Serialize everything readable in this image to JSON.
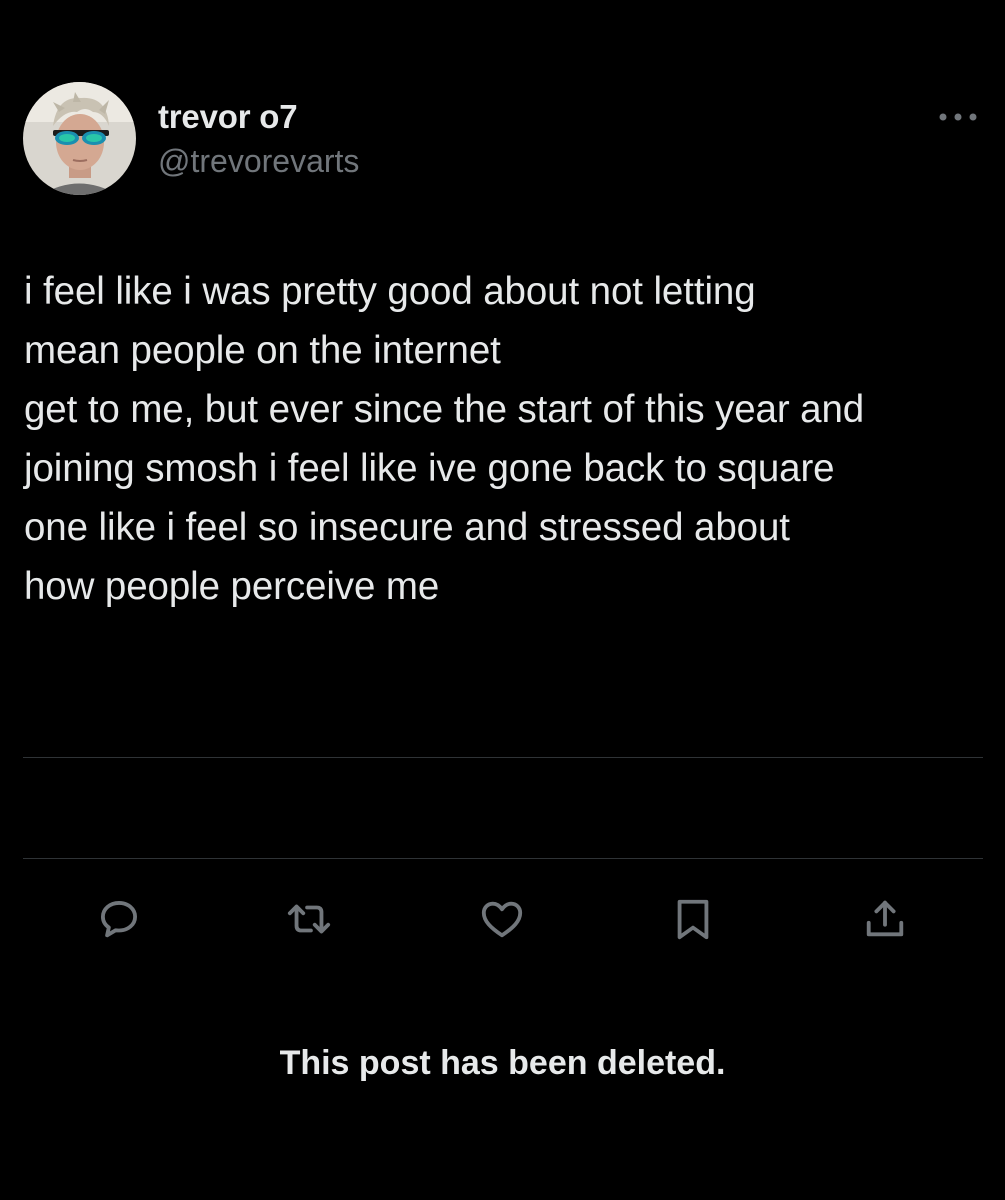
{
  "author": {
    "display_name": "trevor o7",
    "handle": "@trevorevarts",
    "avatar_icon": "profile-photo-avatar"
  },
  "post": {
    "text": "i feel like i was pretty good about not letting\nmean people on the internet\nget to me, but ever since the start of this year and\njoining smosh i feel like ive gone back to square\none like i feel so insecure and stressed about\nhow people perceive me"
  },
  "actions": [
    {
      "name": "reply",
      "icon": "speech-bubble-icon"
    },
    {
      "name": "repost",
      "icon": "repost-arrows-icon"
    },
    {
      "name": "like",
      "icon": "heart-icon"
    },
    {
      "name": "bookmark",
      "icon": "bookmark-icon"
    },
    {
      "name": "share",
      "icon": "share-upload-icon"
    }
  ],
  "more_icon": "ellipsis-icon",
  "notice": "This post has been deleted.",
  "colors": {
    "background": "#000000",
    "primary_text": "#e7e9ea",
    "secondary_text": "#71767b",
    "divider": "#2f3336"
  }
}
